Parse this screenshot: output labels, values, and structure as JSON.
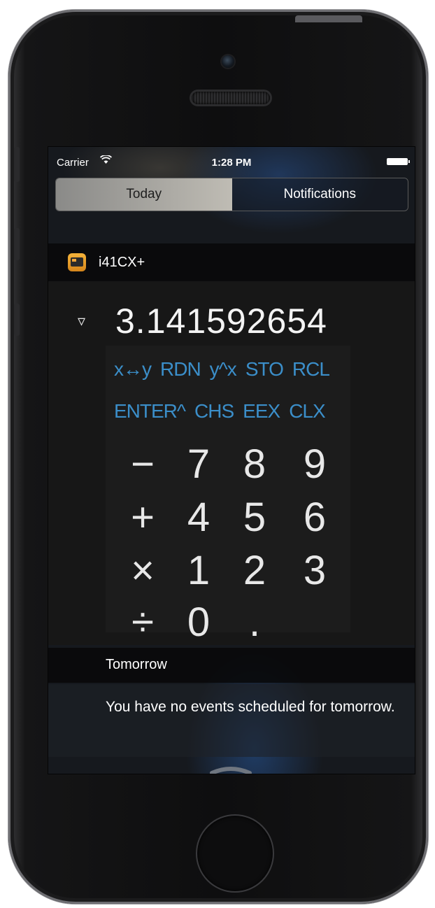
{
  "status_bar": {
    "carrier": "Carrier",
    "wifi_icon": "wifi-icon",
    "time": "1:28 PM",
    "battery_icon": "battery-icon"
  },
  "tabs": [
    {
      "label": "Today",
      "selected": true
    },
    {
      "label": "Notifications",
      "selected": false
    }
  ],
  "widget": {
    "app_name": "i41CX+",
    "toggle_icon": "▿",
    "display_value": "3.141592654",
    "function_row_1": [
      "x↔y",
      "RDN",
      "y^x",
      "STO",
      "RCL"
    ],
    "function_row_2": [
      "ENTER^",
      "CHS",
      "EEX",
      "CLX"
    ],
    "number_rows": [
      [
        "−",
        "7",
        "8",
        "9"
      ],
      [
        "+",
        "4",
        "5",
        "6"
      ],
      [
        "×",
        "1",
        "2",
        "3"
      ],
      [
        "÷",
        "0",
        ".",
        ""
      ]
    ]
  },
  "tomorrow": {
    "title": "Tomorrow",
    "message": "You have no events scheduled for tomorrow."
  },
  "colors": {
    "function_key_color": "#3b8ec9",
    "icon_accent": "#f0a63a"
  }
}
